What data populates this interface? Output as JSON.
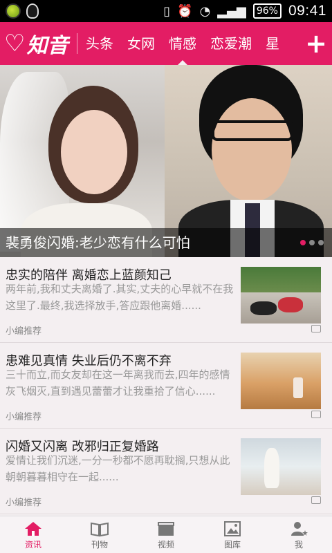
{
  "status_bar": {
    "battery": "96%",
    "time": "09:41"
  },
  "top_nav": {
    "logo_text": "知音",
    "tabs": [
      {
        "label": "头条"
      },
      {
        "label": "女网"
      },
      {
        "label": "情感"
      },
      {
        "label": "恋爱潮"
      },
      {
        "label": "星"
      }
    ],
    "active_tab": "情感",
    "plus_icon": "plus-icon"
  },
  "hero": {
    "title": "裴勇俊闪婚:老少恋有什么可怕",
    "dot_count": 3,
    "active_dot": 0
  },
  "news": [
    {
      "title": "忠实的陪伴 离婚恋上蓝颜知己",
      "summary": "两年前,我和丈夫离婚了.其实,丈夫的心早就不在我这里了.最终,我选择放手,答应跟他离婚......",
      "source": "小编推荐"
    },
    {
      "title": "患难见真情 失业后仍不离不弃",
      "summary": "三十而立,而女友却在这一年离我而去,四年的感情灰飞烟灭,直到遇见蕾蕾才让我重拾了信心......",
      "source": "小编推荐"
    },
    {
      "title": "闪婚又闪离 改邪归正复婚路",
      "summary": "爱情让我们沉迷,一分一秒都不愿再耽搁,只想从此朝朝暮暮相守在一起......",
      "source": "小编推荐"
    }
  ],
  "tabbar": {
    "tabs": [
      {
        "label": "资讯",
        "icon": "home-icon"
      },
      {
        "label": "刊物",
        "icon": "book-icon"
      },
      {
        "label": "视频",
        "icon": "video-icon"
      },
      {
        "label": "图库",
        "icon": "image-icon"
      },
      {
        "label": "我",
        "icon": "user-icon"
      }
    ],
    "active": "资讯"
  },
  "colors": {
    "brand": "#e31d64",
    "background": "#f4eff1"
  }
}
